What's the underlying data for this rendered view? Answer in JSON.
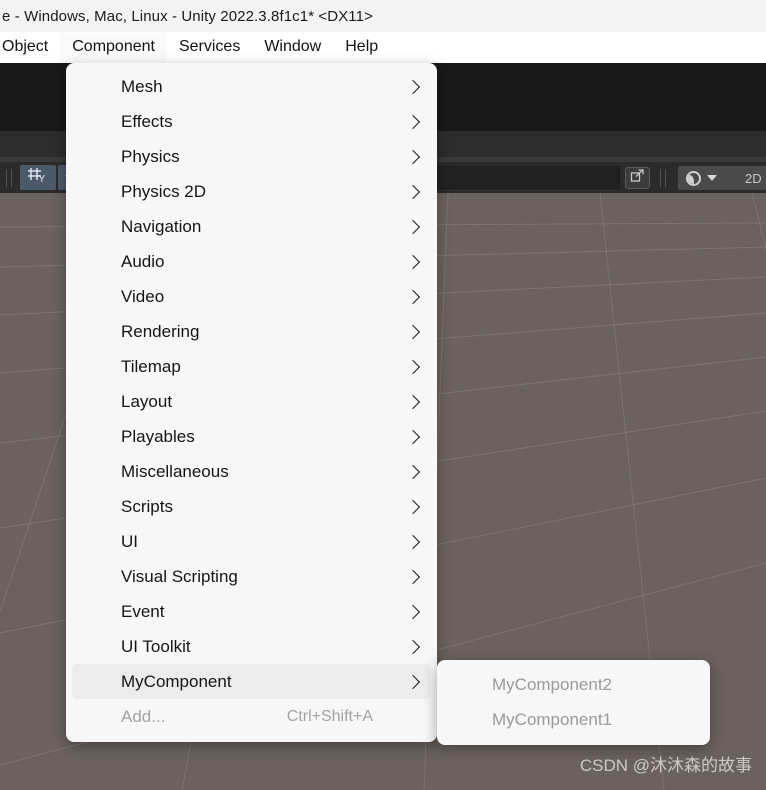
{
  "window": {
    "title": "e - Windows, Mac, Linux - Unity 2022.3.8f1c1* <DX11>"
  },
  "menubar": {
    "items": [
      {
        "label": "Object",
        "active": false
      },
      {
        "label": "Component",
        "active": true
      },
      {
        "label": "Services",
        "active": false
      },
      {
        "label": "Window",
        "active": false
      },
      {
        "label": "Help",
        "active": false
      }
    ]
  },
  "toolbar": {
    "grid_snap_icon": "grid-snap-icon",
    "grid_snap_dropdown_icon": "chevron-down-icon",
    "search_value": "",
    "expand_icon": "expand-icon",
    "shading_mode_icon": "shading-sphere-icon",
    "shading_dropdown_icon": "chevron-down-icon",
    "toggle_2d_label": "2D"
  },
  "component_menu": {
    "items": [
      {
        "label": "Mesh",
        "submenu": true,
        "disabled": false,
        "highlighted": false,
        "shortcut": ""
      },
      {
        "label": "Effects",
        "submenu": true,
        "disabled": false,
        "highlighted": false,
        "shortcut": ""
      },
      {
        "label": "Physics",
        "submenu": true,
        "disabled": false,
        "highlighted": false,
        "shortcut": ""
      },
      {
        "label": "Physics 2D",
        "submenu": true,
        "disabled": false,
        "highlighted": false,
        "shortcut": ""
      },
      {
        "label": "Navigation",
        "submenu": true,
        "disabled": false,
        "highlighted": false,
        "shortcut": ""
      },
      {
        "label": "Audio",
        "submenu": true,
        "disabled": false,
        "highlighted": false,
        "shortcut": ""
      },
      {
        "label": "Video",
        "submenu": true,
        "disabled": false,
        "highlighted": false,
        "shortcut": ""
      },
      {
        "label": "Rendering",
        "submenu": true,
        "disabled": false,
        "highlighted": false,
        "shortcut": ""
      },
      {
        "label": "Tilemap",
        "submenu": true,
        "disabled": false,
        "highlighted": false,
        "shortcut": ""
      },
      {
        "label": "Layout",
        "submenu": true,
        "disabled": false,
        "highlighted": false,
        "shortcut": ""
      },
      {
        "label": "Playables",
        "submenu": true,
        "disabled": false,
        "highlighted": false,
        "shortcut": ""
      },
      {
        "label": "Miscellaneous",
        "submenu": true,
        "disabled": false,
        "highlighted": false,
        "shortcut": ""
      },
      {
        "label": "Scripts",
        "submenu": true,
        "disabled": false,
        "highlighted": false,
        "shortcut": ""
      },
      {
        "label": "UI",
        "submenu": true,
        "disabled": false,
        "highlighted": false,
        "shortcut": ""
      },
      {
        "label": "Visual Scripting",
        "submenu": true,
        "disabled": false,
        "highlighted": false,
        "shortcut": ""
      },
      {
        "label": "Event",
        "submenu": true,
        "disabled": false,
        "highlighted": false,
        "shortcut": ""
      },
      {
        "label": "UI Toolkit",
        "submenu": true,
        "disabled": false,
        "highlighted": false,
        "shortcut": ""
      },
      {
        "label": "MyComponent",
        "submenu": true,
        "disabled": false,
        "highlighted": true,
        "shortcut": ""
      },
      {
        "label": "Add...",
        "submenu": false,
        "disabled": true,
        "highlighted": false,
        "shortcut": "Ctrl+Shift+A"
      }
    ]
  },
  "my_component_submenu": {
    "items": [
      {
        "label": "MyComponent2",
        "disabled": true
      },
      {
        "label": "MyComponent1",
        "disabled": true
      }
    ]
  },
  "watermark": {
    "text": "CSDN @沐沐森的故事"
  },
  "colors": {
    "titlebar_bg": "#f3f3f3",
    "menubar_bg": "#ffffff",
    "menu_bg": "#f7f7f7",
    "menu_highlight": "#ececec",
    "menu_text": "#151515",
    "menu_disabled_text": "#a3a3a3",
    "viewport_bg": "#6b625e",
    "toolbar_bg": "#2b2b2b",
    "accent_blue": "#4b5a6b"
  }
}
